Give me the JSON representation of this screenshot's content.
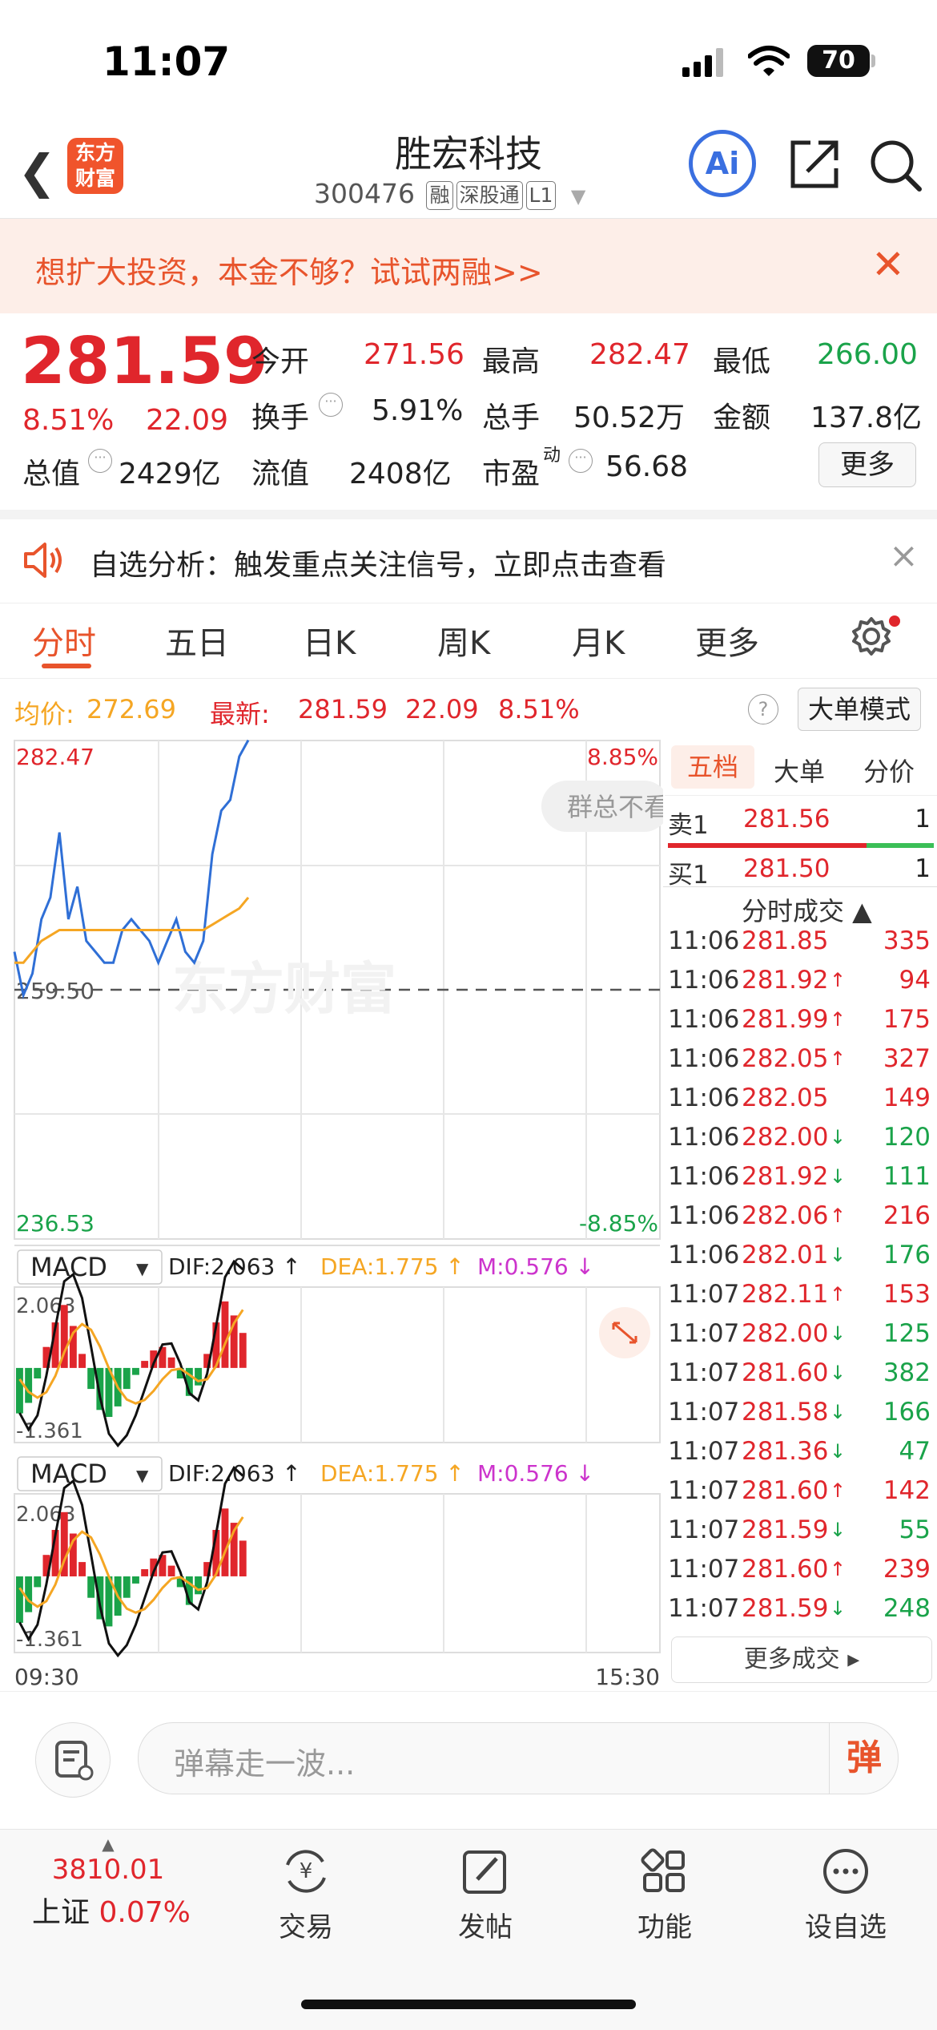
{
  "status": {
    "time": "11:07",
    "battery": "70"
  },
  "header": {
    "stock_name": "胜宏科技",
    "code": "300476",
    "tags": [
      "融",
      "深股通",
      "L1"
    ],
    "logo_text_1": "东方",
    "logo_text_2": "财富",
    "ai_label": "Ai"
  },
  "promo": {
    "text": "想扩大投资，本金不够？试试两融>>"
  },
  "quote": {
    "price": "281.59",
    "change_pct": "8.51%",
    "change": "22.09",
    "open_label": "今开",
    "open": "271.56",
    "high_label": "最高",
    "high": "282.47",
    "low_label": "最低",
    "low": "266.00",
    "turnover_label": "换手",
    "turnover": "5.91%",
    "volume_label": "总手",
    "volume": "50.52万",
    "amount_label": "金额",
    "amount": "137.8亿",
    "mktcap_label": "总值",
    "mktcap": "2429亿",
    "float_label": "流值",
    "float": "2408亿",
    "pe_label": "市盈",
    "pe_sup": "动",
    "pe": "56.68",
    "more_label": "更多"
  },
  "analysis": {
    "text": "自选分析：触发重点关注信号，立即点击查看"
  },
  "tabs": [
    "分时",
    "五日",
    "日K",
    "周K",
    "月K",
    "更多"
  ],
  "infoline": {
    "avg_label": "均价:",
    "avg": "272.69",
    "latest_label": "最新:",
    "latest": "281.59",
    "latest_change": "22.09",
    "latest_pct": "8.51%",
    "bigorder_label": "大单模式"
  },
  "chart": {
    "price_high": "282.47",
    "price_low": "236.53",
    "price_mid": "259.50",
    "pct_high": "8.85%",
    "pct_low": "-8.85%",
    "watermark": "东方财富",
    "group_tip": "群总不看",
    "time_start": "09:30",
    "time_end": "15:30",
    "macd_label": "MACD",
    "dif": "DIF:2.063 ↑",
    "dea": "DEA:1.775 ↑",
    "m": "M:0.576 ↓",
    "macd_high": "2.063",
    "macd_low": "-1.361"
  },
  "chart_data": {
    "type": "line",
    "series": [
      {
        "name": "price",
        "values": [
          263,
          259,
          261,
          266,
          268,
          274,
          266,
          269,
          264,
          263,
          262,
          262,
          265,
          266,
          265,
          264,
          262,
          264,
          266,
          263,
          262,
          264,
          272,
          276,
          277,
          281,
          282.5
        ]
      },
      {
        "name": "avg",
        "values": [
          262,
          262,
          263,
          264,
          264.5,
          265,
          265,
          265,
          265,
          265,
          265,
          265,
          265,
          265,
          265,
          265,
          265,
          265,
          265,
          265,
          265,
          265,
          265.5,
          266,
          266.5,
          267,
          268
        ]
      }
    ],
    "macd_bars": [
      -1.3,
      -1.0,
      -0.3,
      0.6,
      1.3,
      1.8,
      1.2,
      0.4,
      -0.6,
      -1.2,
      -1.4,
      -1.1,
      -0.6,
      -0.2,
      0.2,
      0.5,
      0.6,
      0.3,
      -0.3,
      -0.8,
      -0.5,
      0.4,
      1.3,
      1.9,
      1.5,
      1.0
    ],
    "ylim": [
      236.53,
      282.47
    ]
  },
  "panel": {
    "tabs": [
      "五档",
      "大单",
      "分价"
    ],
    "sell_label": "卖1",
    "sell_price": "281.56",
    "sell_vol": "1",
    "buy_label": "买1",
    "buy_price": "281.50",
    "buy_vol": "1",
    "trades_title": "分时成交 ▲",
    "trades": [
      {
        "t": "11:06",
        "p": "281.85",
        "a": "",
        "v": "335",
        "c": "red"
      },
      {
        "t": "11:06",
        "p": "281.92",
        "a": "↑",
        "v": "94",
        "c": "red"
      },
      {
        "t": "11:06",
        "p": "281.99",
        "a": "↑",
        "v": "175",
        "c": "red"
      },
      {
        "t": "11:06",
        "p": "282.05",
        "a": "↑",
        "v": "327",
        "c": "red"
      },
      {
        "t": "11:06",
        "p": "282.05",
        "a": "",
        "v": "149",
        "c": "red"
      },
      {
        "t": "11:06",
        "p": "282.00",
        "a": "↓",
        "v": "120",
        "c": "green"
      },
      {
        "t": "11:06",
        "p": "281.92",
        "a": "↓",
        "v": "111",
        "c": "green"
      },
      {
        "t": "11:06",
        "p": "282.06",
        "a": "↑",
        "v": "216",
        "c": "red"
      },
      {
        "t": "11:06",
        "p": "282.01",
        "a": "↓",
        "v": "176",
        "c": "green"
      },
      {
        "t": "11:07",
        "p": "282.11",
        "a": "↑",
        "v": "153",
        "c": "red"
      },
      {
        "t": "11:07",
        "p": "282.00",
        "a": "↓",
        "v": "125",
        "c": "green"
      },
      {
        "t": "11:07",
        "p": "281.60",
        "a": "↓",
        "v": "382",
        "c": "green"
      },
      {
        "t": "11:07",
        "p": "281.58",
        "a": "↓",
        "v": "166",
        "c": "green"
      },
      {
        "t": "11:07",
        "p": "281.36",
        "a": "↓",
        "v": "47",
        "c": "green"
      },
      {
        "t": "11:07",
        "p": "281.60",
        "a": "↑",
        "v": "142",
        "c": "red"
      },
      {
        "t": "11:07",
        "p": "281.59",
        "a": "↓",
        "v": "55",
        "c": "green"
      },
      {
        "t": "11:07",
        "p": "281.60",
        "a": "↑",
        "v": "239",
        "c": "red"
      },
      {
        "t": "11:07",
        "p": "281.59",
        "a": "↓",
        "v": "248",
        "c": "green"
      }
    ],
    "more_trades": "更多成交 ▸"
  },
  "danmaku": {
    "placeholder": "弹幕走一波...",
    "btn": "弹"
  },
  "bottomnav": {
    "index_value": "3810.01",
    "index_name": "上证",
    "index_pct": "0.07%",
    "items": [
      "交易",
      "发帖",
      "功能",
      "设自选"
    ]
  }
}
